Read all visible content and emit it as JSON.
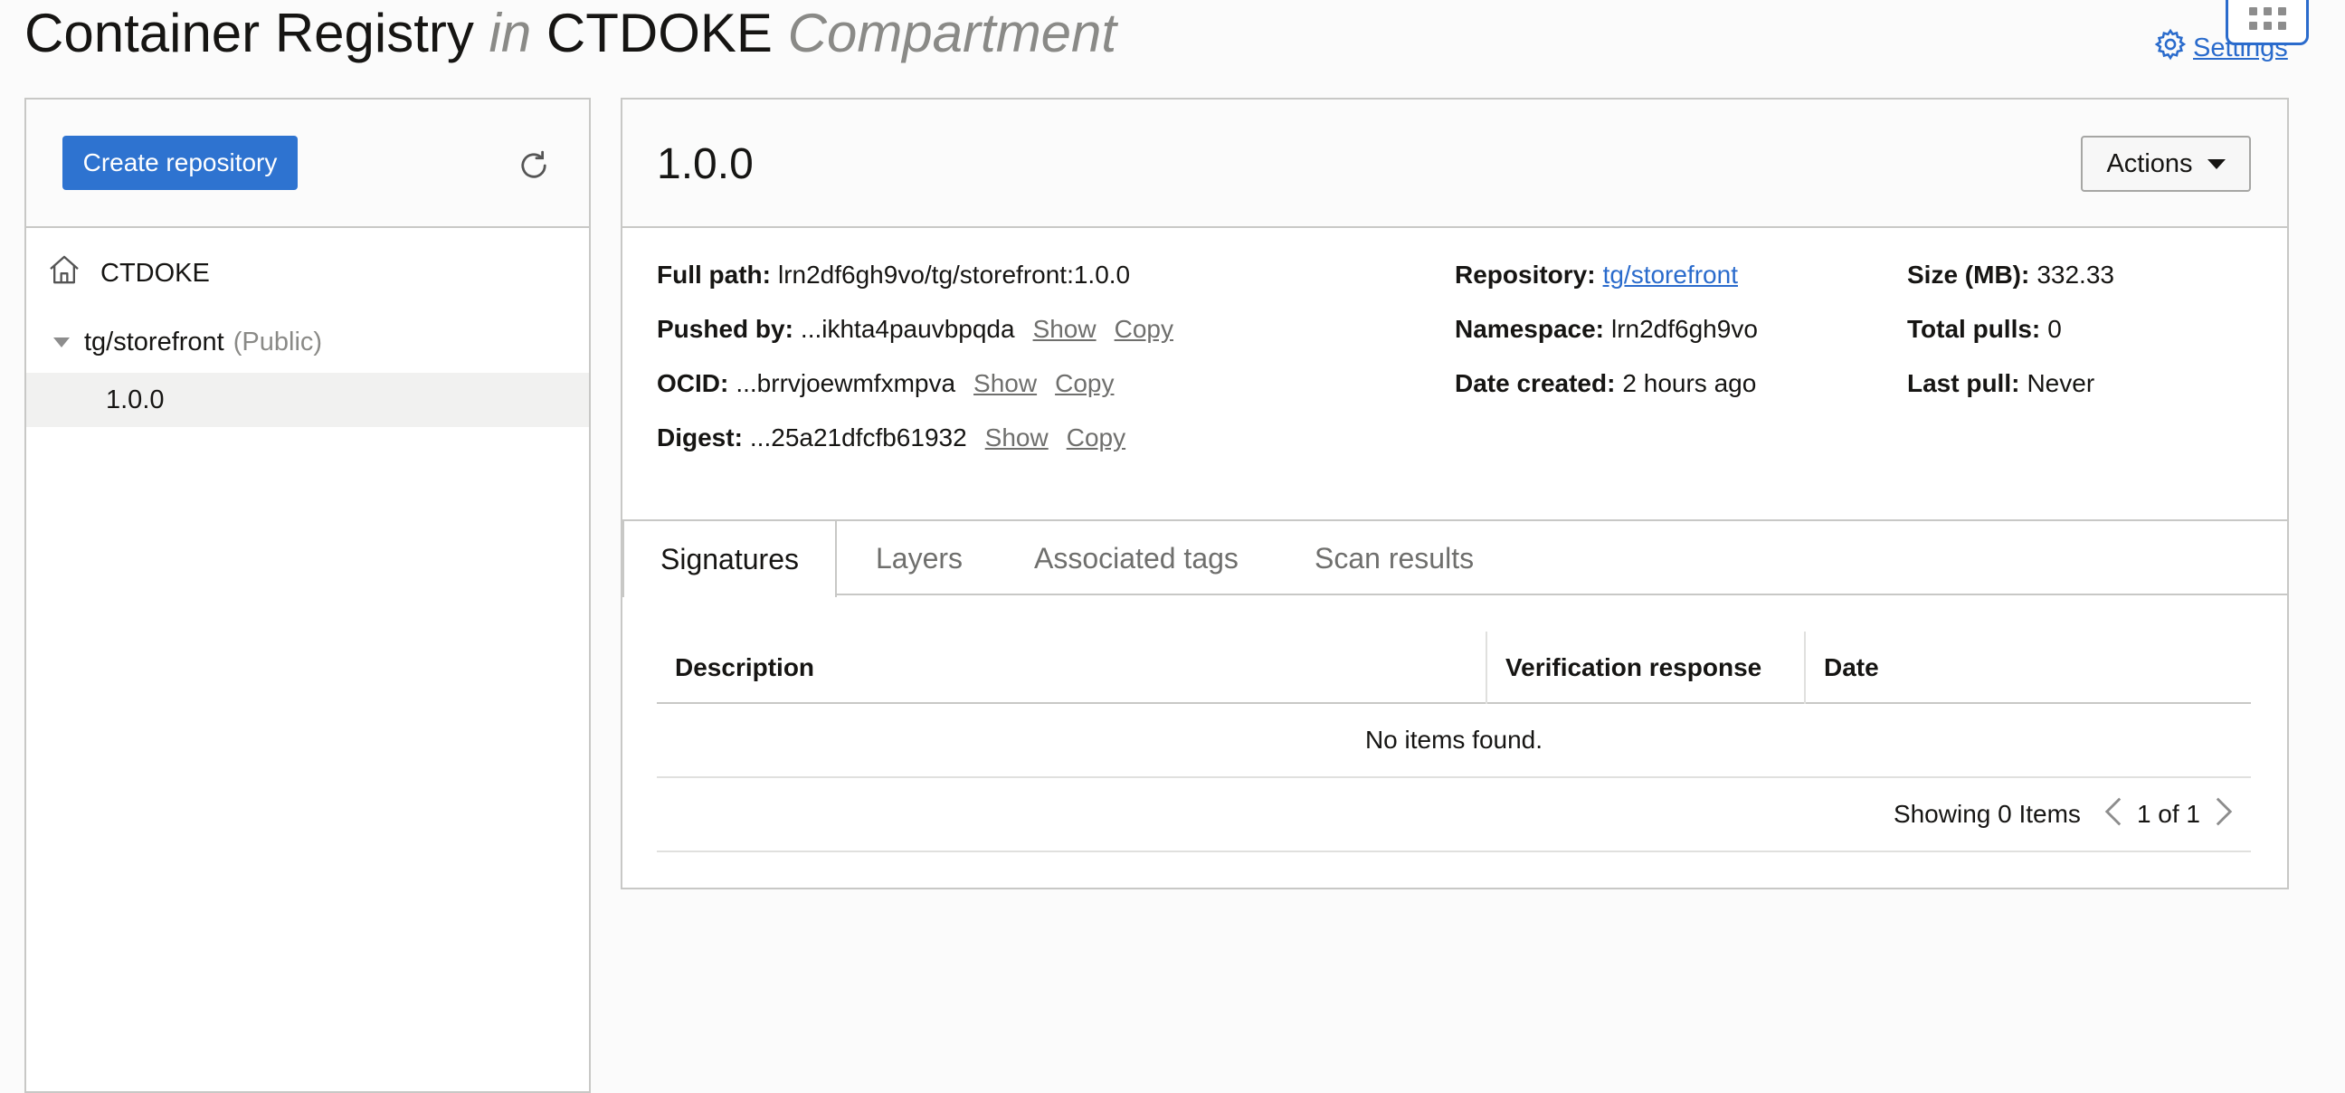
{
  "header": {
    "title_main": "Container Registry",
    "title_in": "in",
    "compartment_name": "CTDOKE",
    "compartment_suffix": "Compartment",
    "settings_label": "Settings",
    "settings_icon": "gear-icon",
    "apps_icon": "app-grid-icon"
  },
  "sidebar": {
    "create_button": "Create repository",
    "refresh_icon": "refresh-icon",
    "root_label": "CTDOKE",
    "root_icon": "home-icon",
    "repository": "tg/storefront",
    "visibility": "(Public)",
    "selected_tag": "1.0.0"
  },
  "detail": {
    "title": "1.0.0",
    "actions_label": "Actions",
    "full_path_label": "Full path:",
    "full_path": "lrn2df6gh9vo/tg/storefront:1.0.0",
    "pushed_by_label": "Pushed by:",
    "pushed_by": "...ikhta4pauvbpqda",
    "ocid_label": "OCID:",
    "ocid": "...brrvjoewmfxmpva",
    "digest_label": "Digest:",
    "digest": "...25a21dfcfb61932",
    "show_label": "Show",
    "copy_label": "Copy",
    "repository_label": "Repository:",
    "repository": "tg/storefront",
    "namespace_label": "Namespace:",
    "namespace": "lrn2df6gh9vo",
    "date_created_label": "Date created:",
    "date_created": "2 hours ago",
    "size_label": "Size (MB):",
    "size": "332.33",
    "total_pulls_label": "Total pulls:",
    "total_pulls": "0",
    "last_pull_label": "Last pull:",
    "last_pull": "Never"
  },
  "tabs": {
    "signatures": "Signatures",
    "layers": "Layers",
    "associated_tags": "Associated tags",
    "scan_results": "Scan results"
  },
  "table": {
    "col_description": "Description",
    "col_verification": "Verification response",
    "col_date": "Date",
    "empty_message": "No items found.",
    "showing": "Showing 0 Items",
    "page_info": "1 of 1"
  },
  "colors": {
    "accent": "#2e73d0",
    "link": "#2a6bcc",
    "border": "#c8c8c6"
  }
}
